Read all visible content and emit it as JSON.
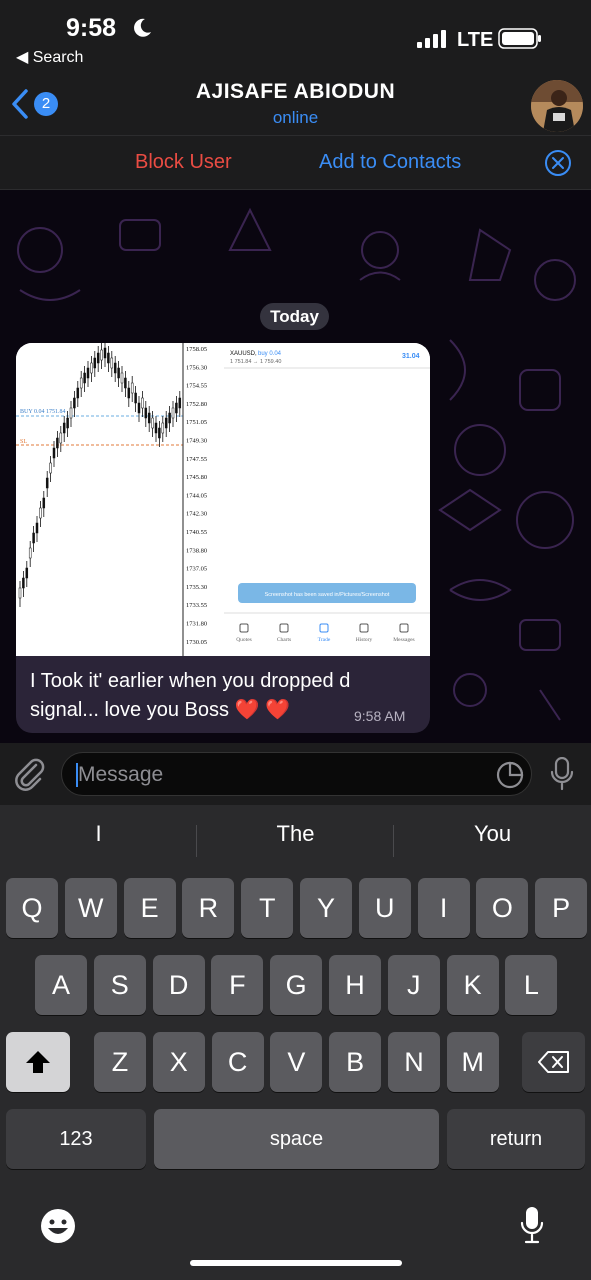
{
  "status_bar": {
    "time": "9:58",
    "back_app": "◀ Search",
    "network": "LTE"
  },
  "header": {
    "back_count": "2",
    "name": "AJISAFE ABIODUN",
    "status": "online"
  },
  "actions": {
    "block": "Block User",
    "add": "Add to Contacts"
  },
  "chat": {
    "date": "Today",
    "message": {
      "text": "I Took it' earlier when you dropped d signal... love you Boss ❤️ ❤️",
      "time": "9:58 AM",
      "image": {
        "price_labels": [
          "1758.05",
          "1756.30",
          "1754.55",
          "1752.80",
          "1751.05",
          "1749.30",
          "1747.55",
          "1745.80",
          "1744.05",
          "1742.30",
          "1740.55",
          "1738.80",
          "1737.05",
          "1735.30",
          "1733.55",
          "1731.80",
          "1730.05"
        ],
        "buy_line": "BUY 0.04 1751.84",
        "sl_label": "SL",
        "symbol": "XAUUSD,",
        "order": "buy 0.04",
        "prices_line": "1 751.84 → 1 759.40",
        "profit": "31.04",
        "toast": "Screenshot has been saved in/Pictures/Screenshot",
        "tabs": [
          "Quotes",
          "Charts",
          "Trade",
          "History",
          "Messages"
        ]
      }
    }
  },
  "input": {
    "placeholder": "Message"
  },
  "keyboard": {
    "suggestions": [
      "I",
      "The",
      "You"
    ],
    "row1": [
      "Q",
      "W",
      "E",
      "R",
      "T",
      "Y",
      "U",
      "I",
      "O",
      "P"
    ],
    "row2": [
      "A",
      "S",
      "D",
      "F",
      "G",
      "H",
      "J",
      "K",
      "L"
    ],
    "row3": [
      "Z",
      "X",
      "C",
      "V",
      "B",
      "N",
      "M"
    ],
    "numbers": "123",
    "space": "space",
    "return": "return"
  },
  "colors": {
    "accent": "#3a8df5",
    "danger": "#ea4c43",
    "bubble": "#2b2438"
  }
}
